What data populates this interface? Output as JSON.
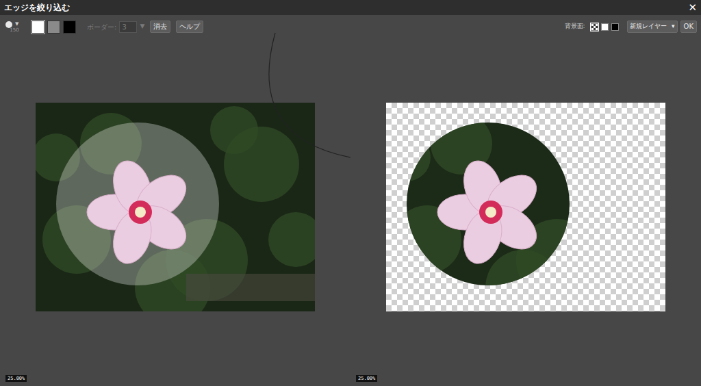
{
  "window": {
    "title": "エッジを絞り込む",
    "close": "✕"
  },
  "toolbar": {
    "brush": {
      "arrow": "▼",
      "size": "150"
    },
    "swatches": [
      {
        "color": "#ffffff",
        "selected": true
      },
      {
        "color": "#8a8a8a",
        "selected": false
      },
      {
        "color": "#000000",
        "selected": false
      }
    ],
    "border": {
      "label": "ボーダー:",
      "value": "3",
      "arrow": "▼",
      "disabled": true
    },
    "buttons": [
      "消去",
      "ヘルプ"
    ],
    "background": {
      "label": "背景面:",
      "options": [
        {
          "kind": "checker",
          "selected": true
        },
        {
          "kind": "white",
          "selected": false
        },
        {
          "kind": "black",
          "selected": false
        }
      ]
    },
    "output": {
      "value": "新規レイヤー",
      "arrow": "▾"
    },
    "ok": "OK"
  },
  "panels": [
    {
      "kind": "source",
      "zoom": "25.00%"
    },
    {
      "kind": "result",
      "zoom": "25.00%"
    }
  ]
}
